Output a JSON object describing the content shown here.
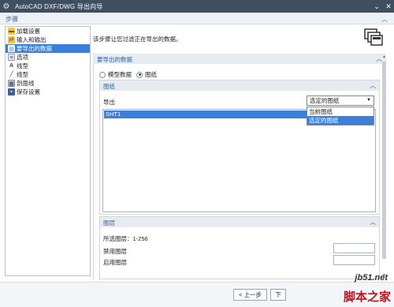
{
  "window": {
    "title": "AutoCAD DXF/DWG 导出向导"
  },
  "header": {
    "steps_label": "步骤"
  },
  "steps": [
    {
      "label": "加载设置",
      "icon": "folder-icon"
    },
    {
      "label": "输入和输出",
      "icon": "io-icon"
    },
    {
      "label": "要导出的数据",
      "icon": "data-icon",
      "active": true
    },
    {
      "label": "选项",
      "icon": "options-icon"
    },
    {
      "label": "线型",
      "icon": "linetype-icon"
    },
    {
      "label": "线型",
      "icon": "line-icon"
    },
    {
      "label": "剖面线",
      "icon": "hatch-icon"
    },
    {
      "label": "保存设置",
      "icon": "save-icon"
    }
  ],
  "description": "该步骤让您过滤正在导出的数据。",
  "section": {
    "title": "要导出的数据",
    "radio_model": "模型数据",
    "radio_drawing": "图纸",
    "selected": "drawing"
  },
  "drawing_panel": {
    "title": "图纸",
    "export_label": "导出",
    "select_value": "选定的图纸",
    "options": [
      "当前图纸",
      "选定的图纸"
    ],
    "list_items": [
      "SHT1"
    ]
  },
  "layer_panel": {
    "title": "图层",
    "selected_layers": "所选图层：1-256",
    "disabled_layers_label": "禁用图层",
    "enabled_layers_label": "启用图层"
  },
  "footer": {
    "back_button": "< 上一步",
    "next_button": "下"
  },
  "watermark": {
    "top": "jb51.net",
    "bottom": "脚本之家"
  },
  "colors": {
    "titlebar": "#3f4f61",
    "accent": "#3b7fd8",
    "section_text": "#2f62a8",
    "watermark_red": "#c0121a"
  }
}
